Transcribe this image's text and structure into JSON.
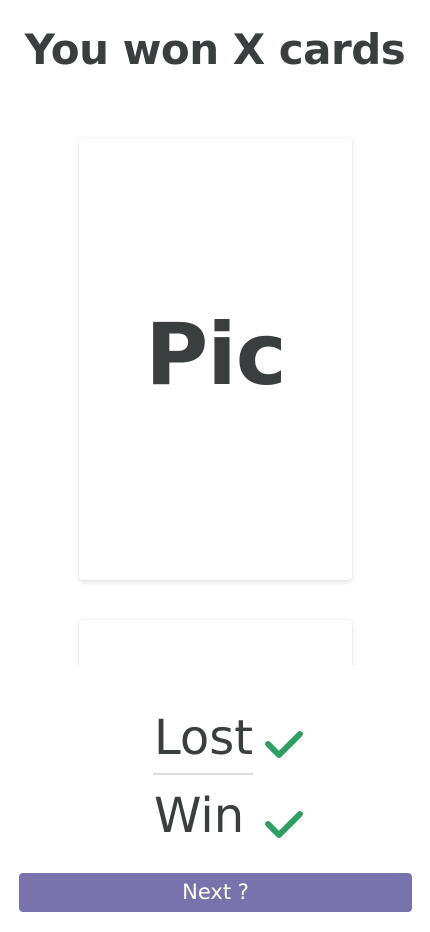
{
  "header": {
    "title": "You won X cards"
  },
  "cards": [
    {
      "label": "Pic"
    },
    {
      "label": ""
    }
  ],
  "results": [
    {
      "label": "Lost",
      "icon": "check-icon",
      "icon_color": "#2e9e63"
    },
    {
      "label": "Win",
      "icon": "check-icon",
      "icon_color": "#2e9e63"
    }
  ],
  "footer": {
    "next_label": "Next ?",
    "button_color": "#7873ac"
  }
}
